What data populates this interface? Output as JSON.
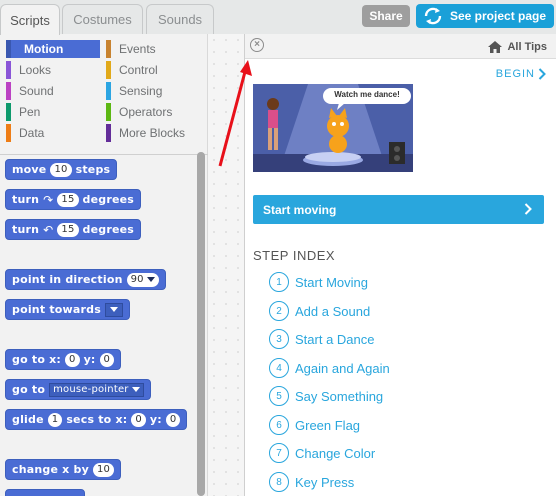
{
  "tabs": [
    "Scripts",
    "Costumes",
    "Sounds"
  ],
  "header": {
    "share_label": "Share",
    "see_project_label": "See project page"
  },
  "categories": [
    {
      "label": "Motion",
      "color": "#4a6cd4",
      "selected": true
    },
    {
      "label": "Events",
      "color": "#c88330"
    },
    {
      "label": "Looks",
      "color": "#8a55d7"
    },
    {
      "label": "Control",
      "color": "#e1a91a"
    },
    {
      "label": "Sound",
      "color": "#bb42c3"
    },
    {
      "label": "Sensing",
      "color": "#2ca5e2"
    },
    {
      "label": "Pen",
      "color": "#0e9a6c"
    },
    {
      "label": "Operators",
      "color": "#5cb712"
    },
    {
      "label": "Data",
      "color": "#ee7d16"
    },
    {
      "label": "More Blocks",
      "color": "#632d99"
    }
  ],
  "blocks": {
    "move": {
      "a": "move",
      "v": "10",
      "b": "steps"
    },
    "turn_right": {
      "a": "turn",
      "v": "15",
      "b": "degrees"
    },
    "turn_left": {
      "a": "turn",
      "v": "15",
      "b": "degrees"
    },
    "point_dir": {
      "a": "point in direction",
      "v": "90"
    },
    "point_towards": {
      "a": "point towards"
    },
    "goto_xy": {
      "a": "go to x:",
      "x": "0",
      "b": "y:",
      "y": "0"
    },
    "goto": {
      "a": "go to",
      "v": "mouse-pointer"
    },
    "glide": {
      "a": "glide",
      "v": "1",
      "b": "secs to x:",
      "x": "0",
      "c": "y:",
      "y": "0"
    },
    "change_x": {
      "a": "change x by",
      "v": "10"
    }
  },
  "tips": {
    "all_tips": "All Tips",
    "begin": "BEGIN",
    "thumb_caption": "Watch me dance!",
    "start_button": "Start moving",
    "step_index_title": "STEP INDEX",
    "steps": [
      {
        "n": "1",
        "label": "Start Moving"
      },
      {
        "n": "2",
        "label": "Add a Sound"
      },
      {
        "n": "3",
        "label": "Start a Dance"
      },
      {
        "n": "4",
        "label": "Again and Again"
      },
      {
        "n": "5",
        "label": "Say Something"
      },
      {
        "n": "6",
        "label": "Green Flag"
      },
      {
        "n": "7",
        "label": "Change Color"
      },
      {
        "n": "8",
        "label": "Key Press"
      }
    ]
  },
  "icons": {
    "close": "close-circle-icon",
    "home": "home-icon",
    "sync": "sync-arrows-icon",
    "rotate_cw": "rotate-clockwise-icon",
    "rotate_ccw": "rotate-counterclockwise-icon"
  },
  "colors": {
    "accent": "#29a6dd",
    "motion": "#4a6cd4",
    "annotation_arrow": "#e8101a"
  }
}
